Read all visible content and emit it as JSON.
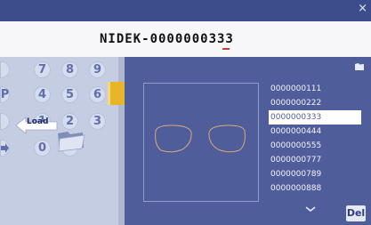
{
  "window": {
    "close_glyph": "×"
  },
  "header": {
    "job_id": "NIDEK-0000000333"
  },
  "keypad": {
    "keys": [
      "7",
      "8",
      "9",
      "4",
      "5",
      "6",
      "1",
      "2",
      "3",
      "0",
      "·"
    ],
    "left_edge_labels": [
      "",
      "P",
      "",
      ""
    ]
  },
  "actions": {
    "load_label": "Load",
    "delete_label": "Del"
  },
  "job_list": {
    "items": [
      "0000000111",
      "0000000222",
      "0000000333",
      "0000000444",
      "0000000555",
      "0000000777",
      "0000000789",
      "0000000888"
    ],
    "selected_index": 2
  },
  "icons": {
    "close": "close-icon",
    "load": "arrow-left-icon",
    "folder": "folder-icon",
    "scroll": "chevron-down-icon"
  },
  "colors": {
    "panel_blue": "#4f5d9b",
    "title_bar": "#3d4c8a",
    "accent_yellow": "#e7b528",
    "cursor_red": "#d23a2a"
  }
}
